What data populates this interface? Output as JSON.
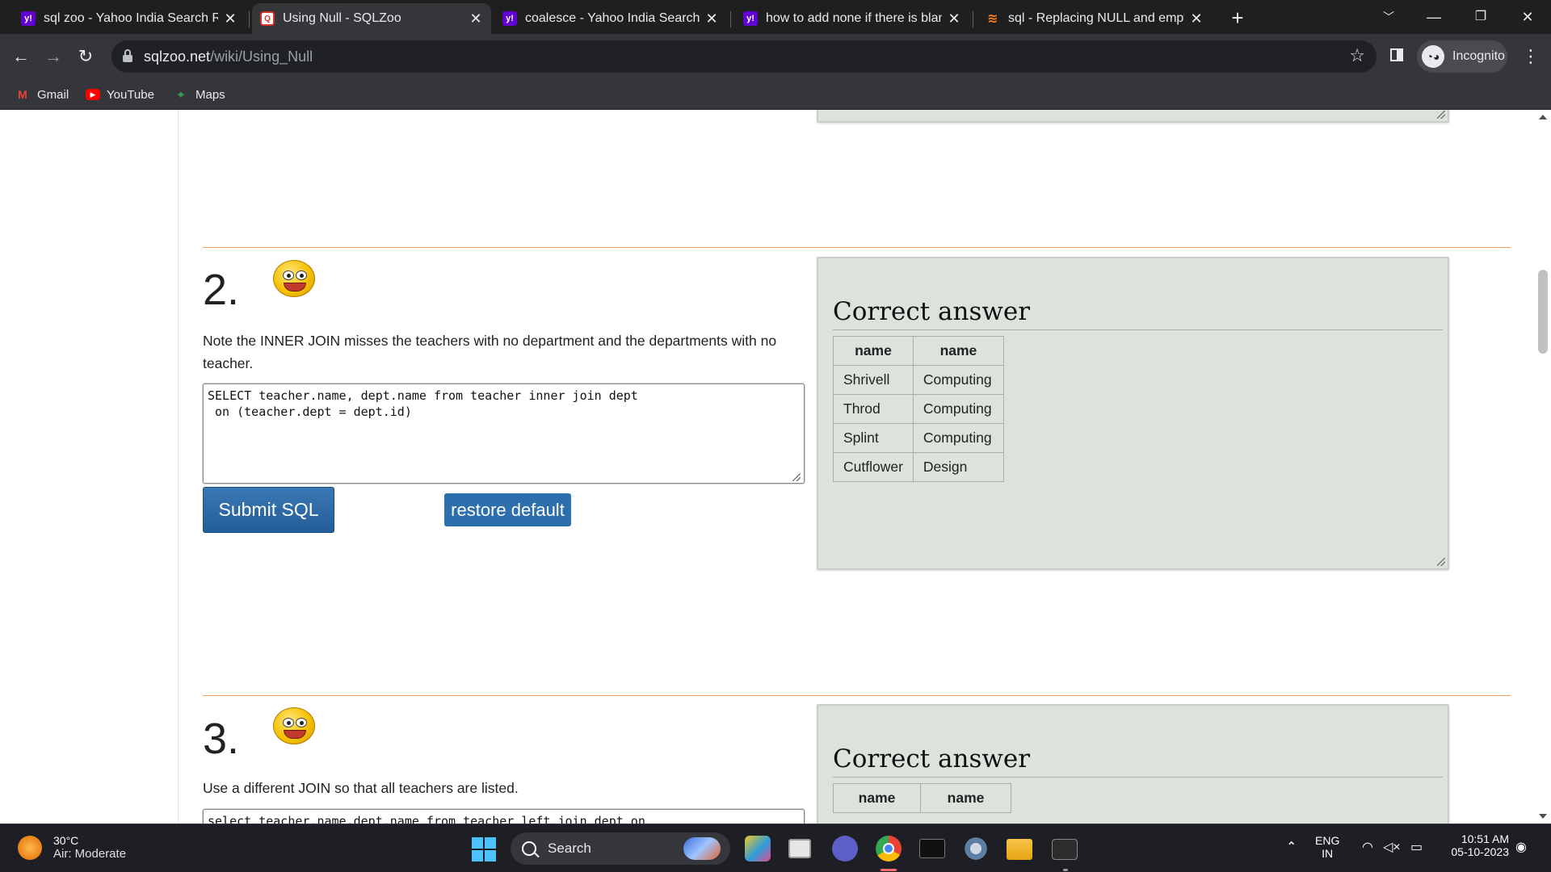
{
  "browser": {
    "tabs": [
      {
        "title": "sql zoo - Yahoo India Search Res",
        "favicon": "yahoo-icon",
        "active": false
      },
      {
        "title": "Using Null - SQLZoo",
        "favicon": "sqlzoo-icon",
        "active": true
      },
      {
        "title": "coalesce - Yahoo India Search Re",
        "favicon": "yahoo-icon",
        "active": false
      },
      {
        "title": "how to add none if there is blank",
        "favicon": "yahoo-icon",
        "active": false
      },
      {
        "title": "sql - Replacing NULL and empty",
        "favicon": "stackoverflow-icon",
        "active": false
      }
    ],
    "url_host": "sqlzoo.net",
    "url_path": "/wiki/Using_Null",
    "profile_label": "Incognito",
    "bookmarks": [
      {
        "label": "Gmail",
        "icon": "gmail-icon"
      },
      {
        "label": "YouTube",
        "icon": "youtube-icon"
      },
      {
        "label": "Maps",
        "icon": "maps-icon"
      }
    ]
  },
  "page": {
    "question2": {
      "number": "2.",
      "text": "Note the INNER JOIN misses the teachers with no department and the departments with no teacher.",
      "sql": "SELECT teacher.name, dept.name from teacher inner join dept\n on (teacher.dept = dept.id)",
      "submit_label": "Submit SQL",
      "restore_label": "restore default",
      "answer_title": "Correct answer",
      "columns": [
        "name",
        "name"
      ],
      "rows": [
        [
          "Shrivell",
          "Computing"
        ],
        [
          "Throd",
          "Computing"
        ],
        [
          "Splint",
          "Computing"
        ],
        [
          "Cutflower",
          "Design"
        ]
      ]
    },
    "question3": {
      "number": "3.",
      "text": "Use a different JOIN so that all teachers are listed.",
      "sql": "select teacher.name,dept.name from teacher left join dept on",
      "answer_title": "Correct answer",
      "columns": [
        "name",
        "name"
      ]
    }
  },
  "taskbar": {
    "weather_temp": "30°C",
    "weather_desc": "Air: Moderate",
    "search_label": "Search",
    "lang_top": "ENG",
    "lang_bottom": "IN",
    "time": "10:51 AM",
    "date": "05-10-2023"
  },
  "colors": {
    "accent_orange": "#f0a05a",
    "answer_bg": "#dce3dc",
    "button_blue": "#2d6fac"
  }
}
